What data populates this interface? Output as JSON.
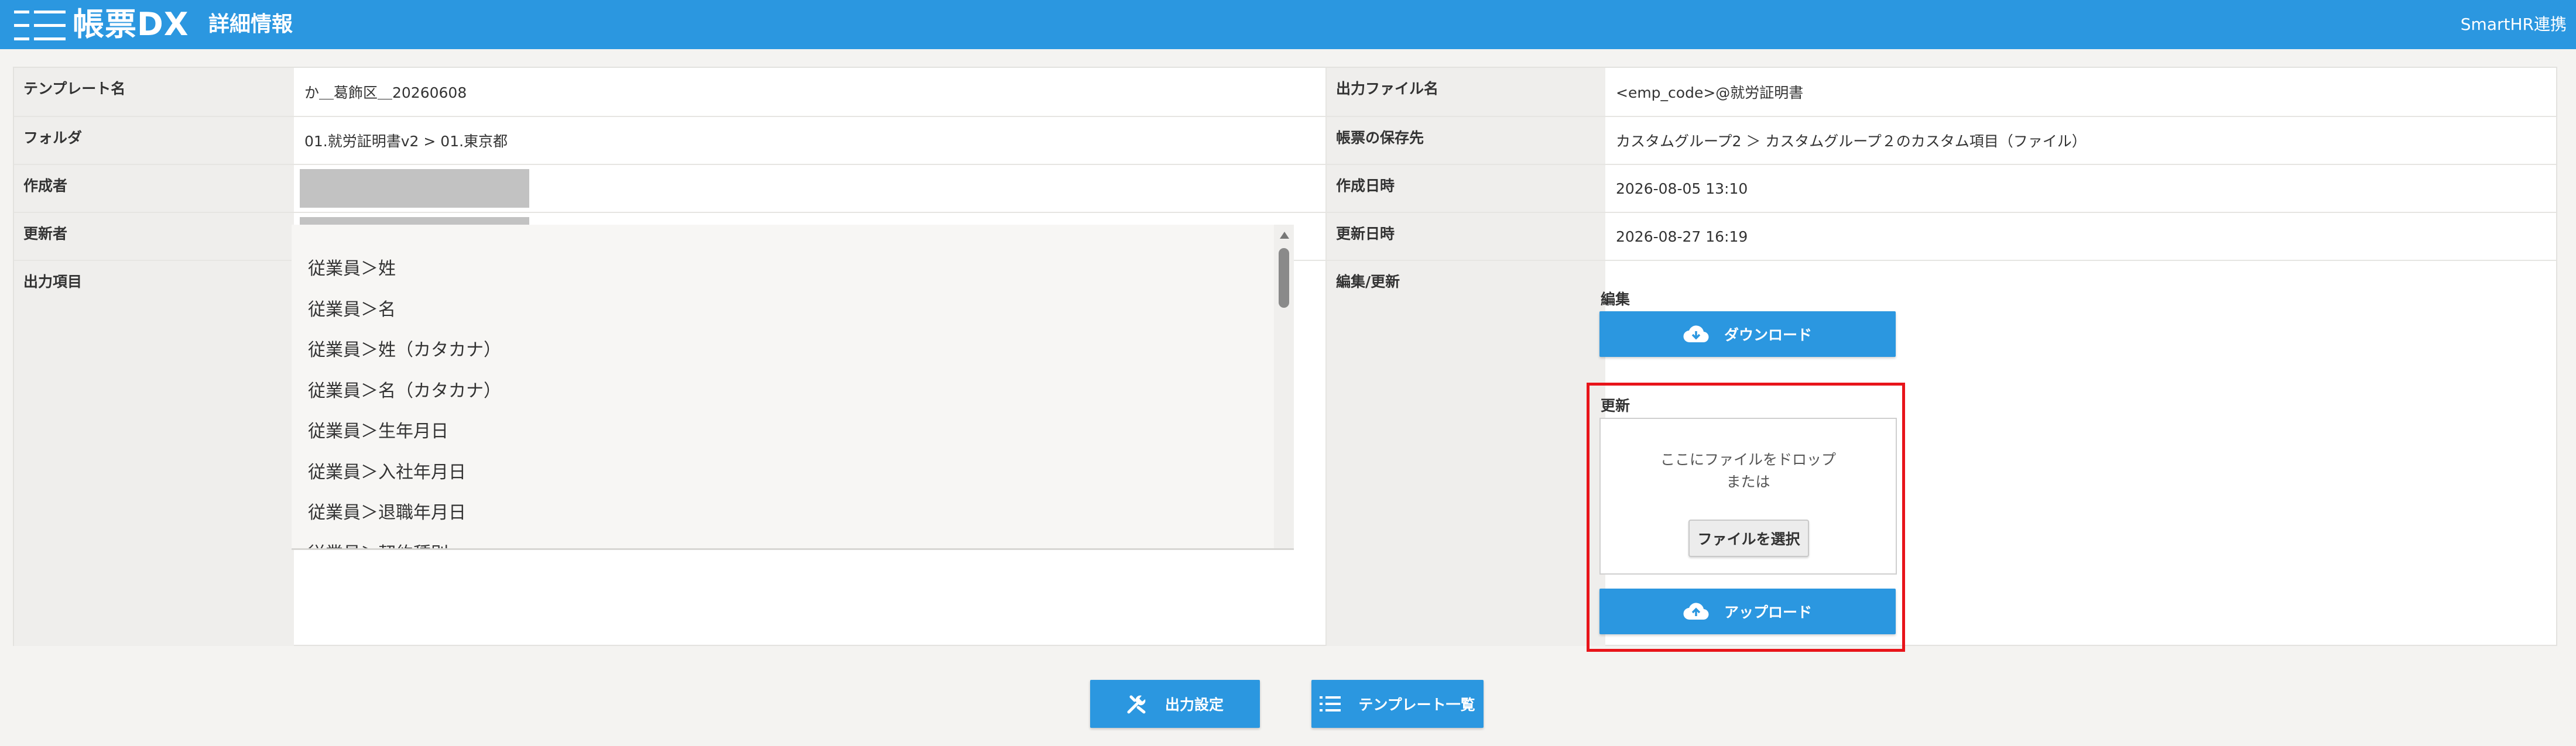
{
  "header": {
    "logo_text": "帳票DX",
    "title": "詳細情報",
    "smarthr_link": "SmartHR連携"
  },
  "details": {
    "template_name_label": "テンプレート名",
    "template_name": "か＿葛飾区＿20260608",
    "folder_label": "フォルダ",
    "folder": "01.就労証明書v2 > 01.東京都",
    "creator_label": "作成者",
    "updater_label": "更新者",
    "output_items_label": "出力項目",
    "output_file_label": "出力ファイル名",
    "output_file": "<emp_code>@就労証明書",
    "save_dest_label": "帳票の保存先",
    "save_dest": "カスタムグループ2 ＞ カスタムグループ２のカスタム項目（ファイル）",
    "created_at_label": "作成日時",
    "created_at": "2026-08-05 13:10",
    "updated_at_label": "更新日時",
    "updated_at": "2026-08-27 16:19",
    "edit_update_label": "編集/更新"
  },
  "output_items": [
    "従業員＞姓",
    "従業員＞名",
    "従業員＞姓（カタカナ）",
    "従業員＞名（カタカナ）",
    "従業員＞生年月日",
    "従業員＞入社年月日",
    "従業員＞退職年月日",
    "従業員＞契約種別"
  ],
  "edit": {
    "edit_label": "編集",
    "download_button": "ダウンロード",
    "update_label": "更新",
    "drop_line1": "ここにファイルをドロップ",
    "drop_line2": "または",
    "choose_file_button": "ファイルを選択",
    "upload_button": "アップロード"
  },
  "footer": {
    "output_settings_button": "出力設定",
    "template_list_button": "テンプレート一覧"
  },
  "colors": {
    "header_bg": "#2b97e0",
    "button_blue": "#2b97e0",
    "highlight_red": "#e8141a",
    "label_bg": "#efeeec",
    "redacted": "#c2c2c2"
  },
  "icons": [
    "menu-lines-icon",
    "cloud-download-icon",
    "cloud-upload-icon",
    "tools-icon",
    "list-icon"
  ]
}
